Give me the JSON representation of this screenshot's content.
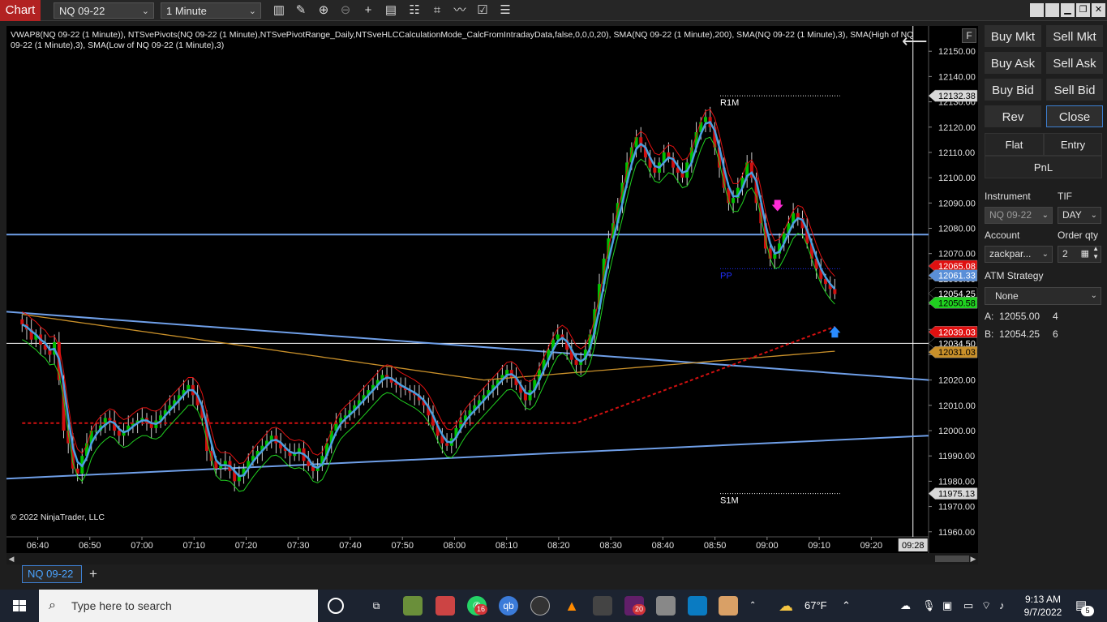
{
  "toolbar": {
    "chart_tab": "Chart",
    "instrument": "NQ 09-22",
    "interval": "1 Minute",
    "icons": [
      "bar-type-icon",
      "draw-pencil-icon",
      "zoom-in-icon",
      "zoom-out-icon",
      "crosshair-icon",
      "data-box-icon",
      "strategies-icon",
      "indicators-icon",
      "properties-icon",
      "more-icon"
    ],
    "window_buttons": [
      "restore-icon",
      "restore-icon",
      "minimize-icon",
      "maximize-icon",
      "close-icon"
    ]
  },
  "chart": {
    "indicator_line": "VWAP8(NQ 09-22 (1 Minute)), NTSvePivots(NQ 09-22 (1 Minute),NTSvePivotRange_Daily,NTSveHLCCalculationMode_CalcFromIntradayData,false,0,0,0,20), SMA(NQ 09-22 (1 Minute),200), SMA(NQ 09-22 (1 Minute),3), SMA(High of NQ 09-22 (1 Minute),3), SMA(Low of NQ 09-22 (1 Minute),3)",
    "copyright": "© 2022 NinjaTrader, LLC",
    "f_label": "F",
    "pivot_labels": {
      "r1": "R1M",
      "pp": "PP",
      "s1": "S1M"
    },
    "crosshair_time": "09:28",
    "colors": {
      "up": "#00c000",
      "down": "#d01010",
      "sma3": "#4a9fe0",
      "upper": "#e01010",
      "lower": "#20d020",
      "vwap": "#d01010",
      "sma200": "#c9902a",
      "trend": "#6f9fe8"
    }
  },
  "chart_data": {
    "type": "candlestick",
    "x_ticks": [
      "06:40",
      "06:50",
      "07:00",
      "07:10",
      "07:20",
      "07:30",
      "07:40",
      "07:50",
      "08:00",
      "08:10",
      "08:20",
      "08:30",
      "08:40",
      "08:50",
      "09:00",
      "09:10",
      "09:20"
    ],
    "y_ticks": [
      12150,
      12140,
      12130,
      12120,
      12110,
      12100,
      12090,
      12080,
      12070,
      12060,
      12050,
      12040,
      12030,
      12020,
      12010,
      12000,
      11990,
      11980,
      11970,
      11960
    ],
    "y_tick_labels": [
      "12150.00",
      "12140.00",
      "12130.00",
      "12120.00",
      "12110.00",
      "12100.00",
      "12090.00",
      "12080.00",
      "12070.00",
      "12060.00",
      "12050.00",
      "12040.00",
      "12030.00",
      "12020.00",
      "12010.00",
      "12000.00",
      "11990.00",
      "11980.00",
      "11970.00",
      "11960.00"
    ],
    "ylim": [
      11958,
      12160
    ],
    "time_range": [
      "06:34",
      "09:31"
    ],
    "price_markers": [
      {
        "label": "12132.38",
        "value": 12132.38,
        "bg": "#d8d8d8",
        "fg": "#000000"
      },
      {
        "label": "12065.08",
        "value": 12065.08,
        "bg": "#e01010",
        "fg": "#ffffff"
      },
      {
        "label": "12061.33",
        "value": 12061.33,
        "bg": "#5a8fd8",
        "fg": "#ffffff"
      },
      {
        "label": "12054.25",
        "value": 12054.25,
        "bg": "#000000",
        "fg": "#ffffff"
      },
      {
        "label": "12050.58",
        "value": 12050.58,
        "bg": "#20d020",
        "fg": "#000000"
      },
      {
        "label": "12039.03",
        "value": 12039.03,
        "bg": "#e01010",
        "fg": "#ffffff"
      },
      {
        "label": "12034.50",
        "value": 12034.5,
        "bg": "#000000",
        "fg": "#ffffff"
      },
      {
        "label": "12031.03",
        "value": 12031.03,
        "bg": "#c9902a",
        "fg": "#000000"
      },
      {
        "label": "11975.13",
        "value": 11975.13,
        "bg": "#d8d8d8",
        "fg": "#000000"
      }
    ],
    "horizontal_lines": {
      "blue_level": 12077.5,
      "crosshair_price": 12034.5,
      "r1": 12132.38,
      "pp": 12064.0,
      "s1": 11975.13
    },
    "trendlines": [
      {
        "from": [
          "06:34",
          12047
        ],
        "to": [
          "09:31",
          12020
        ]
      },
      {
        "from": [
          "06:34",
          11981
        ],
        "to": [
          "09:31",
          11998
        ]
      }
    ],
    "closes": [
      12042,
      12040,
      12036,
      12038,
      12034,
      12032,
      12030,
      12035,
      12020,
      12000,
      11995,
      11985,
      11983,
      11990,
      11995,
      12000,
      12000,
      12002,
      12005,
      12004,
      12000,
      11998,
      12000,
      12002,
      12003,
      12004,
      12005,
      12003,
      12001,
      12004,
      12006,
      12008,
      12010,
      12012,
      12014,
      12016,
      12018,
      12014,
      12010,
      12005,
      11992,
      11988,
      11985,
      11986,
      11988,
      11984,
      11980,
      11982,
      11985,
      11988,
      11990,
      11992,
      11994,
      11996,
      11998,
      11995,
      11993,
      11992,
      11990,
      11991,
      11993,
      11988,
      11986,
      11984,
      11986,
      11990,
      11995,
      12000,
      12003,
      12005,
      12006,
      12008,
      12010,
      12012,
      12014,
      12016,
      12018,
      12020,
      12022,
      12021,
      12019,
      12018,
      12017,
      12016,
      12015,
      12014,
      12012,
      12010,
      12006,
      12002,
      11998,
      11995,
      11994,
      11997,
      12001,
      12004,
      12006,
      12008,
      12010,
      12012,
      12014,
      12016,
      12018,
      12020,
      12022,
      12024,
      12021,
      12018,
      12015,
      12012,
      12016,
      12020,
      12024,
      12028,
      12032,
      12036,
      12038,
      12036,
      12032,
      12028,
      12026,
      12028,
      12032,
      12038,
      12048,
      12058,
      12068,
      12076,
      12082,
      12090,
      12098,
      12106,
      12112,
      12116,
      12112,
      12108,
      12104,
      12102,
      12106,
      12110,
      12108,
      12104,
      12102,
      12100,
      12106,
      12112,
      12118,
      12122,
      12124,
      12120,
      12112,
      12104,
      12096,
      12090,
      12092,
      12096,
      12100,
      12106,
      12100,
      12090,
      12082,
      12072,
      12068,
      12070,
      12074,
      12078,
      12082,
      12086,
      12084,
      12080,
      12074,
      12068,
      12064,
      12060,
      12058,
      12056,
      12054
    ],
    "arrows": [
      {
        "time": "09:02",
        "price": 12088,
        "dir": "down",
        "color": "#ff2bd6"
      },
      {
        "time": "09:13",
        "price": 12040,
        "dir": "up",
        "color": "#2a8cff"
      }
    ]
  },
  "order_panel": {
    "buttons": [
      "Buy Mkt",
      "Sell Mkt",
      "Buy Ask",
      "Sell Ask",
      "Buy Bid",
      "Sell Bid",
      "Rev",
      "Close"
    ],
    "seg_flat": "Flat",
    "seg_entry": "Entry",
    "seg_pnl": "PnL",
    "instrument_label": "Instrument",
    "instrument_value": "NQ 09-22",
    "tif_label": "TIF",
    "tif_value": "DAY",
    "account_label": "Account",
    "account_value": "zackpar...",
    "order_qty_label": "Order qty",
    "order_qty_value": "2",
    "atm_label": "ATM Strategy",
    "atm_value": "None",
    "ask_label": "A:",
    "ask_price": "12055.00",
    "ask_size": "4",
    "bid_label": "B:",
    "bid_price": "12054.25",
    "bid_size": "6"
  },
  "tabs": {
    "instrument": "NQ 09-22",
    "add": "+"
  },
  "taskbar": {
    "search_placeholder": "Type here to search",
    "apps": [
      {
        "name": "cortana-icon",
        "badge": ""
      },
      {
        "name": "task-view-icon",
        "badge": ""
      },
      {
        "name": "app-icon-1",
        "badge": ""
      },
      {
        "name": "app-icon-2",
        "badge": ""
      },
      {
        "name": "whatsapp-icon",
        "badge": "16"
      },
      {
        "name": "qbittorrent-icon",
        "badge": ""
      },
      {
        "name": "obs-icon",
        "badge": ""
      },
      {
        "name": "vlc-icon",
        "badge": ""
      },
      {
        "name": "ninjatrader-icon",
        "badge": ""
      },
      {
        "name": "slack-icon",
        "badge": "20"
      },
      {
        "name": "app-icon-3",
        "badge": ""
      },
      {
        "name": "app-icon-4",
        "badge": ""
      },
      {
        "name": "app-icon-5",
        "badge": ""
      }
    ],
    "weather": "67°F",
    "time": "9:13 AM",
    "date": "9/7/2022",
    "notifications": "5"
  }
}
